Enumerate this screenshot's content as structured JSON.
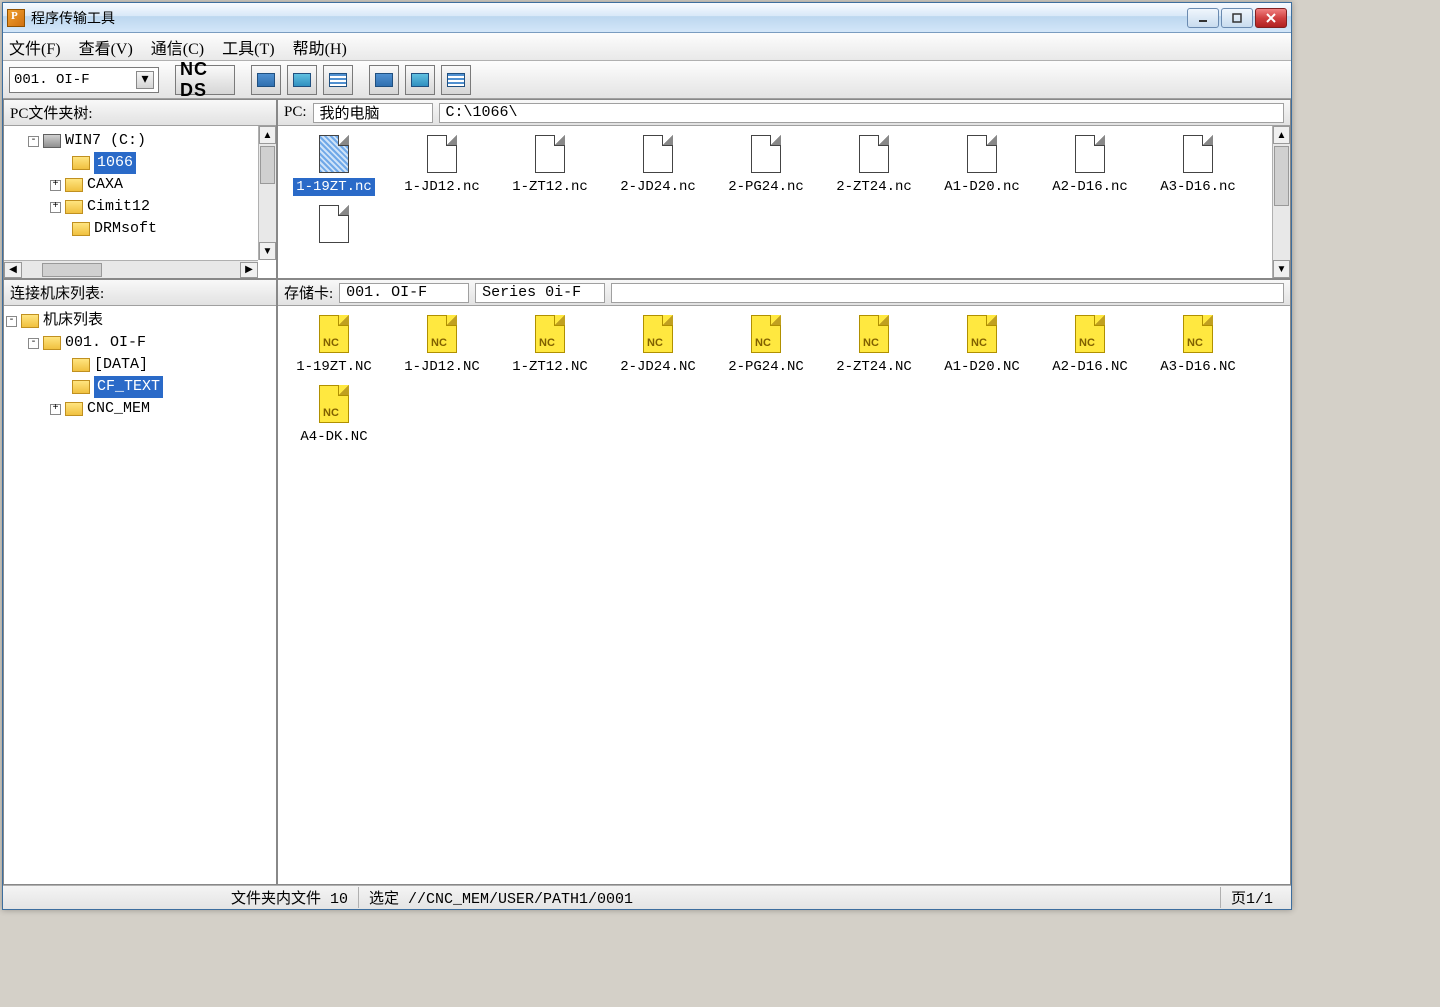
{
  "window": {
    "title": "程序传输工具"
  },
  "menu": {
    "file": "文件(F)",
    "view": "查看(V)",
    "comm": "通信(C)",
    "tool": "工具(T)",
    "help": "帮助(H)"
  },
  "toolbar": {
    "combo_value": "001. OI-F",
    "ncds": "NC DS"
  },
  "left_top": {
    "header": "PC文件夹树:",
    "nodes": [
      {
        "indent": 1,
        "exp": "-",
        "icon": "drive",
        "label": "WIN7 (C:)",
        "selected": false
      },
      {
        "indent": 2,
        "exp": "",
        "icon": "folder",
        "label": "1066",
        "selected": true
      },
      {
        "indent": 2,
        "exp": "+",
        "icon": "folder",
        "label": "CAXA",
        "selected": false
      },
      {
        "indent": 2,
        "exp": "+",
        "icon": "folder",
        "label": "Cimit12",
        "selected": false
      },
      {
        "indent": 2,
        "exp": "",
        "icon": "folder",
        "label": "DRMsoft",
        "selected": false
      }
    ]
  },
  "right_top": {
    "label_pc": "PC:",
    "field_machine": "我的电脑",
    "field_path": "C:\\1066\\",
    "files": [
      {
        "name": "1-19ZT.nc",
        "selected": true
      },
      {
        "name": "1-JD12.nc"
      },
      {
        "name": "1-ZT12.nc"
      },
      {
        "name": "2-JD24.nc"
      },
      {
        "name": "2-PG24.nc"
      },
      {
        "name": "2-ZT24.nc"
      },
      {
        "name": "A1-D20.nc"
      },
      {
        "name": "A2-D16.nc"
      },
      {
        "name": "A3-D16.nc"
      }
    ],
    "extra_file": true
  },
  "left_bot": {
    "header": "连接机床列表:",
    "nodes": [
      {
        "indent": 0,
        "exp": "-",
        "icon": "list",
        "label": "机床列表",
        "selected": false
      },
      {
        "indent": 1,
        "exp": "-",
        "icon": "list",
        "label": "001. OI-F",
        "selected": false
      },
      {
        "indent": 2,
        "exp": "",
        "icon": "folder",
        "label": "[DATA]",
        "selected": false
      },
      {
        "indent": 2,
        "exp": "",
        "icon": "folder",
        "label": "CF_TEXT",
        "selected": true
      },
      {
        "indent": 2,
        "exp": "+",
        "icon": "folder",
        "label": "CNC_MEM",
        "selected": false
      }
    ]
  },
  "right_bot": {
    "label_card": "存储卡:",
    "field_system": "001. OI-F",
    "field_series": "Series 0i-F",
    "files": [
      {
        "name": "1-19ZT.NC"
      },
      {
        "name": "1-JD12.NC"
      },
      {
        "name": "1-ZT12.NC"
      },
      {
        "name": "2-JD24.NC"
      },
      {
        "name": "2-PG24.NC"
      },
      {
        "name": "2-ZT24.NC"
      },
      {
        "name": "A1-D20.NC"
      },
      {
        "name": "A2-D16.NC"
      },
      {
        "name": "A3-D16.NC"
      },
      {
        "name": "A4-DK.NC"
      }
    ]
  },
  "status": {
    "file_count_label": "文件夹内文件 10",
    "selected_label": "选定 //CNC_MEM/USER/PATH1/0001",
    "page_label": "页1/1"
  }
}
